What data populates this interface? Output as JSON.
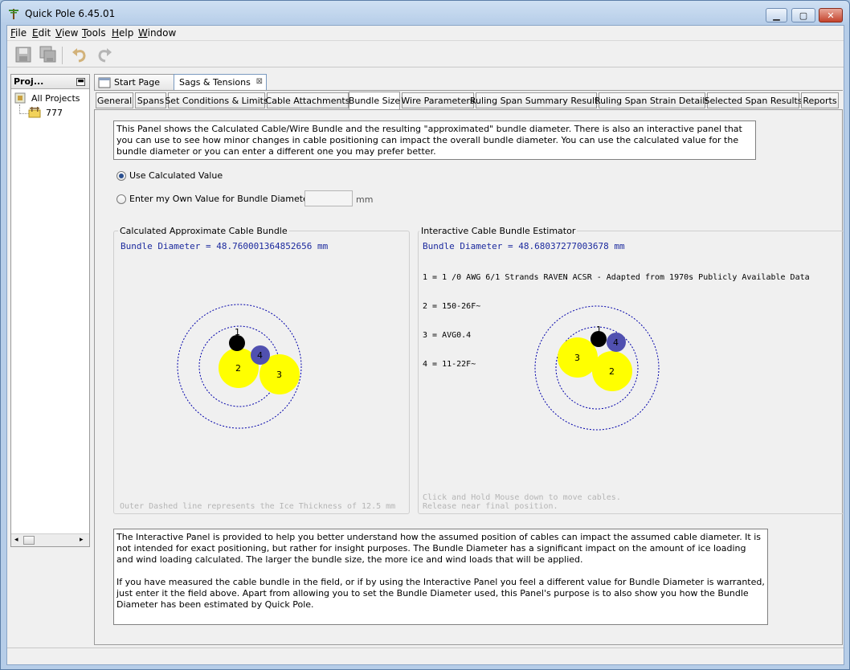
{
  "window": {
    "title": "Quick Pole 6.45.01",
    "controls": [
      "minimize",
      "maximize",
      "close"
    ]
  },
  "menu": {
    "items": [
      {
        "label": "File",
        "mnemonic": "F",
        "rest": "ile"
      },
      {
        "label": "Edit",
        "mnemonic": "E",
        "rest": "dit"
      },
      {
        "label": "View",
        "mnemonic": "V",
        "rest": "iew"
      },
      {
        "label": "Tools",
        "mnemonic": "T",
        "rest": "ools"
      },
      {
        "label": "Help",
        "mnemonic": "H",
        "rest": "elp"
      },
      {
        "label": "Window",
        "mnemonic": "W",
        "rest": "indow"
      }
    ]
  },
  "toolbar": {
    "icons": [
      "save-icon",
      "save-all-icon",
      "undo-icon",
      "redo-icon"
    ]
  },
  "projects": {
    "header": "Proj...",
    "root": "All Projects",
    "children": [
      "777"
    ]
  },
  "doc_tabs": [
    {
      "label": "Start Page",
      "active": false
    },
    {
      "label": "Sags & Tensions",
      "active": true,
      "close": "⊠"
    }
  ],
  "sub_tabs": [
    {
      "label": "General"
    },
    {
      "label": "Spans"
    },
    {
      "label": "Set Conditions & Limits"
    },
    {
      "label": "Cable Attachments"
    },
    {
      "label": "Bundle Size",
      "selected": true
    },
    {
      "label": "Wire Parameters"
    },
    {
      "label": "Ruling Span Summary Results"
    },
    {
      "label": "Ruling Span Strain Details"
    },
    {
      "label": "Selected Span Results"
    },
    {
      "label": "Reports"
    }
  ],
  "panel": {
    "intro": "This Panel shows the Calculated Cable/Wire Bundle and the resulting \"approximated\" bundle diameter. There is also an interactive panel that you can use to see how minor changes in cable positioning can impact the overall bundle diameter. You can use the calculated value for the bundle diameter or you can enter a different one you may prefer better.",
    "option_calculated": "Use Calculated Value",
    "option_own": "Enter my Own Value for Bundle Diameter",
    "selected_option": "calculated",
    "own_value": "",
    "unit": "mm",
    "calculated": {
      "title": "Calculated Approximate Cable Bundle",
      "diameter": "Bundle Diameter = 48.760001364852656 mm",
      "footer": "Outer Dashed line represents the Ice Thickness of 12.5 mm",
      "cables": [
        {
          "label": "1",
          "color": "#000000"
        },
        {
          "label": "2",
          "color": "#ffff00"
        },
        {
          "label": "3",
          "color": "#ffff00"
        },
        {
          "label": "4",
          "color": "#5050b0"
        }
      ]
    },
    "interactive": {
      "title": "Interactive Cable Bundle Estimator",
      "diameter": "Bundle Diameter = 48.68037277003678 mm",
      "legend": [
        "1 = 1 /0 AWG 6/1 Strands RAVEN ACSR - Adapted from 1970s Publicly Available Data",
        "2 = 150-26F~",
        "3 = AVG0.4",
        "4 = 11-22F~"
      ],
      "hint_line1": "Click and Hold Mouse down to move cables.",
      "hint_line2": "Release near final position.",
      "cables": [
        {
          "label": "1",
          "color": "#000000"
        },
        {
          "label": "2",
          "color": "#ffff00"
        },
        {
          "label": "3",
          "color": "#ffff00"
        },
        {
          "label": "4",
          "color": "#5050b0"
        }
      ]
    },
    "info_para1": "The Interactive Panel is provided to help you better understand how the assumed position of cables can impact the assumed cable diameter. It is not intended for exact positioning, but rather for insight purposes. The Bundle Diameter has a significant impact on the amount of ice loading and wind loading calculated. The larger the bundle size, the more ice and wind loads that will be applied.",
    "info_para2": "If you have measured the cable bundle in the field, or if by using the Interactive Panel you feel a different value for Bundle Diameter is warranted, just enter it the field above. Apart from allowing you to set the Bundle Diameter used, this Panel's purpose is to also show you how the Bundle Diameter has been estimated by Quick Pole."
  },
  "colors": {
    "accent_blue": "#1c2a9e",
    "dash_circle": "#0000aa",
    "cable_yellow": "#ffff00",
    "cable_purple": "#5050b0",
    "hint_gray": "#b5b5b5"
  }
}
